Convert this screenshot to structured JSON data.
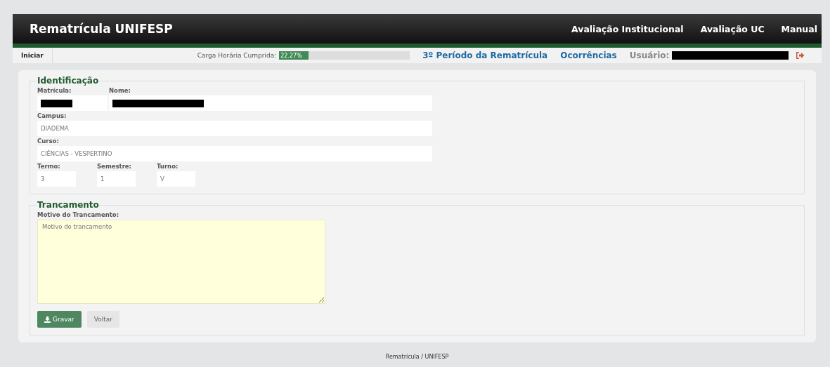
{
  "header": {
    "title": "Rematrícula UNIFESP",
    "nav": [
      "Avaliação Institucional",
      "Avaliação UC",
      "Manual"
    ]
  },
  "subbar": {
    "home": "Iniciar",
    "progress_label": "Carga Horária Cumprida:",
    "progress_text": "22.27%",
    "level": 0.2227,
    "links": [
      "3º Período da Rematrícula",
      "Ocorrências"
    ],
    "user_label": "Usuário:"
  },
  "identificacao": {
    "legend": "Identificação",
    "rows": [
      [
        {
          "label": "Matrícula:",
          "kind": "redacted"
        },
        {
          "label": "Nome:",
          "kind": "redacted"
        }
      ],
      [
        {
          "label": "Campus:",
          "kind": "text",
          "value": "DIADEMA"
        }
      ],
      [
        {
          "label": "Curso:",
          "kind": "text",
          "value": "CIÊNCIAS - VESPERTINO"
        }
      ],
      [
        {
          "label": "Termo:",
          "kind": "text",
          "value": "3"
        },
        {
          "label": "Semestre:",
          "kind": "text",
          "value": "1"
        },
        {
          "label": "Turno:",
          "kind": "text",
          "value": "V"
        }
      ]
    ]
  },
  "trancamento": {
    "legend": "Trancamento",
    "label": "Motivo do Trancamento:",
    "value": "Motivo do trancamento",
    "buttons": [
      {
        "label": "Gravar",
        "kind": "primary"
      },
      {
        "label": "Voltar",
        "kind": "secondary"
      }
    ]
  },
  "footer": "Rematrícula / UNIFESP"
}
